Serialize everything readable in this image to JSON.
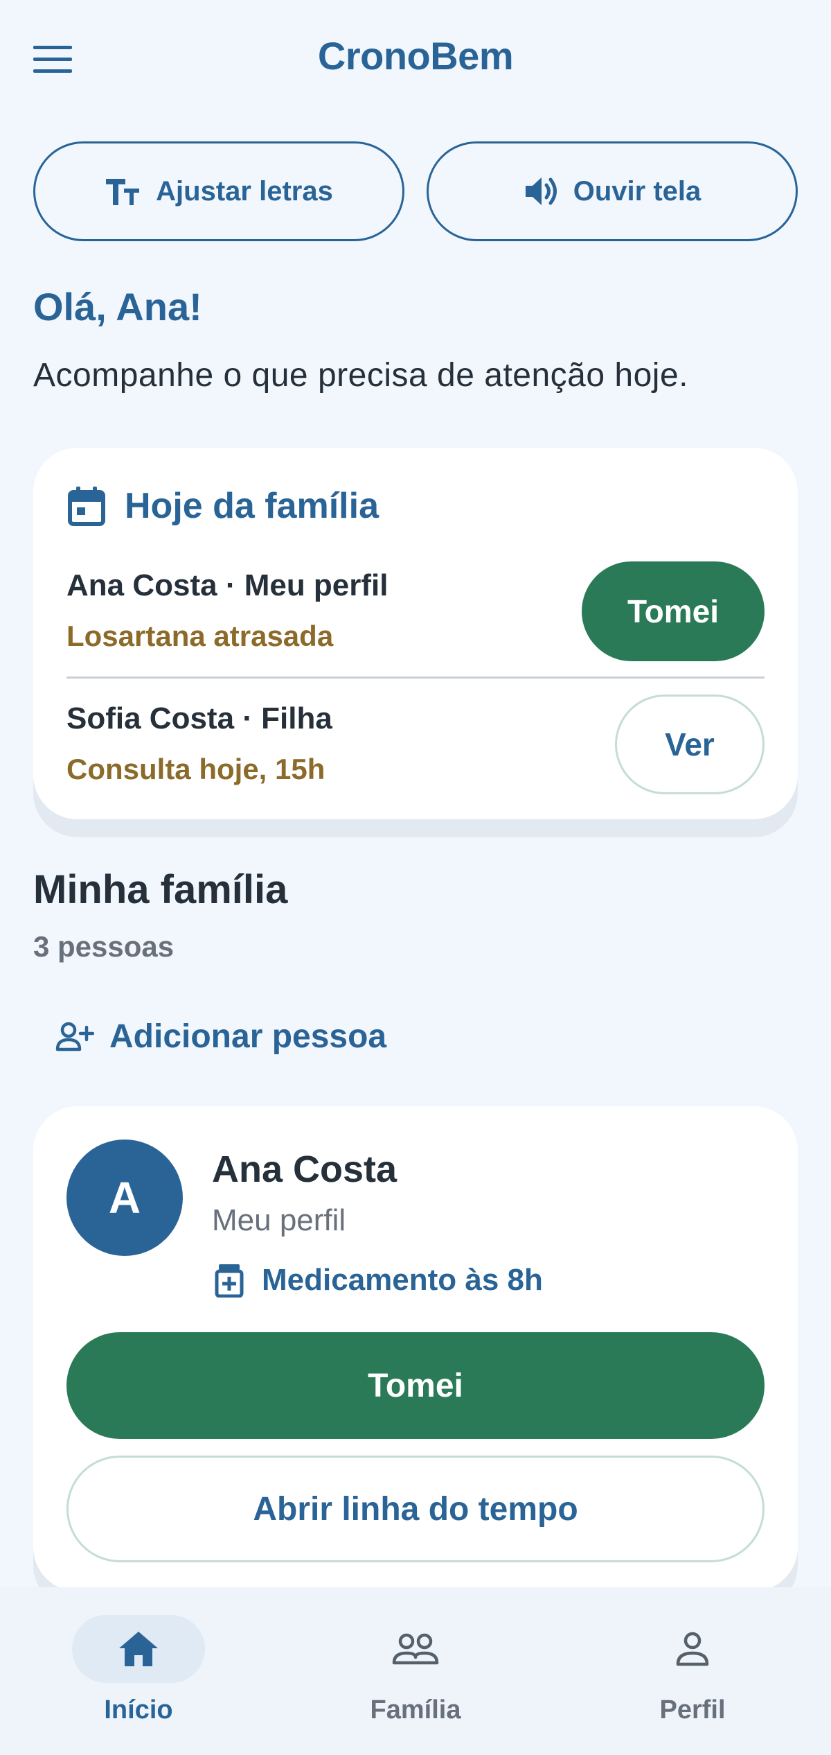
{
  "header": {
    "app_title": "CronoBem",
    "menu_icon": "menu-icon"
  },
  "accessibility": {
    "adjust_letters_label": "Ajustar letras",
    "adjust_letters_icon": "text-size-icon",
    "listen_screen_label": "Ouvir tela",
    "listen_screen_icon": "speaker-icon"
  },
  "greeting": {
    "title": "Olá, Ana!",
    "subtitle": "Acompanhe o que precisa de atenção hoje."
  },
  "today": {
    "title": "Hoje da família",
    "icon": "calendar-icon",
    "rows": [
      {
        "name": "Ana Costa · Meu perfil",
        "status": "Losartana atrasada",
        "action": "Tomei"
      },
      {
        "name": "Sofia Costa · Filha",
        "status": "Consulta hoje, 15h",
        "action": "Ver"
      }
    ]
  },
  "family": {
    "title": "Minha família",
    "count": "3 pessoas",
    "add_label": "Adicionar pessoa",
    "add_icon": "add-person-icon",
    "members": [
      {
        "initial": "A",
        "name": "Ana Costa",
        "role": "Meu perfil",
        "next_event": "Medicamento às 8h",
        "next_event_icon": "medication-icon",
        "primary_action": "Tomei",
        "secondary_action": "Abrir linha do tempo"
      }
    ]
  },
  "bottom_nav": {
    "items": [
      {
        "label": "Início",
        "icon": "home-icon",
        "active": true
      },
      {
        "label": "Família",
        "icon": "family-icon",
        "active": false
      },
      {
        "label": "Perfil",
        "icon": "person-icon",
        "active": false
      }
    ]
  },
  "colors": {
    "primary": "#2a6497",
    "success": "#2a7a58",
    "warning_text": "#8c6a2a",
    "background": "#f1f7fd"
  }
}
